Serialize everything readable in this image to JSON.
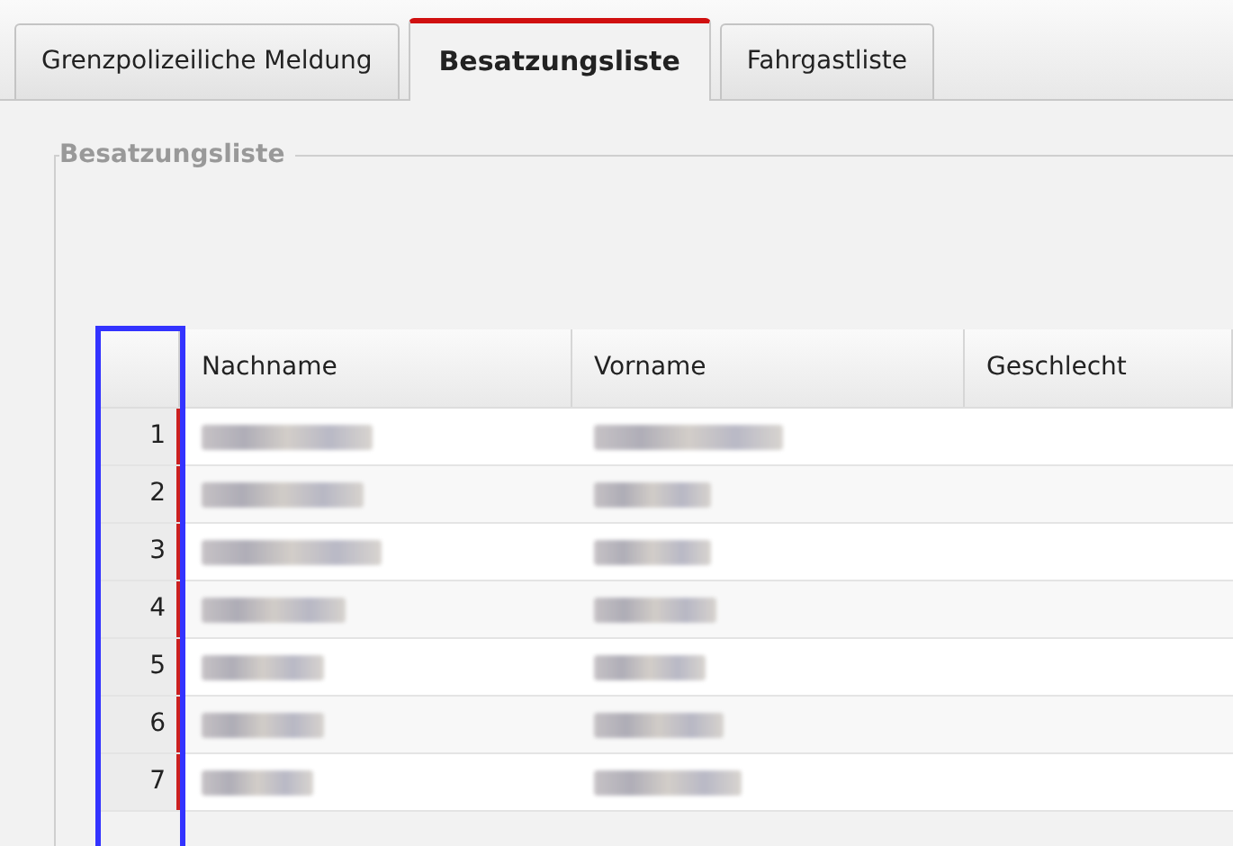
{
  "tabs": [
    {
      "label": "Grenzpolizeiliche Meldung",
      "selected": false
    },
    {
      "label": "Besatzungsliste",
      "selected": true
    },
    {
      "label": "Fahrgastliste",
      "selected": false
    }
  ],
  "section": {
    "legend": "Besatzungsliste"
  },
  "table": {
    "columns": [
      "Nachname",
      "Vorname",
      "Geschlecht"
    ],
    "rows": [
      {
        "number": "1"
      },
      {
        "number": "2"
      },
      {
        "number": "3"
      },
      {
        "number": "4"
      },
      {
        "number": "5"
      },
      {
        "number": "6"
      },
      {
        "number": "7"
      }
    ]
  }
}
